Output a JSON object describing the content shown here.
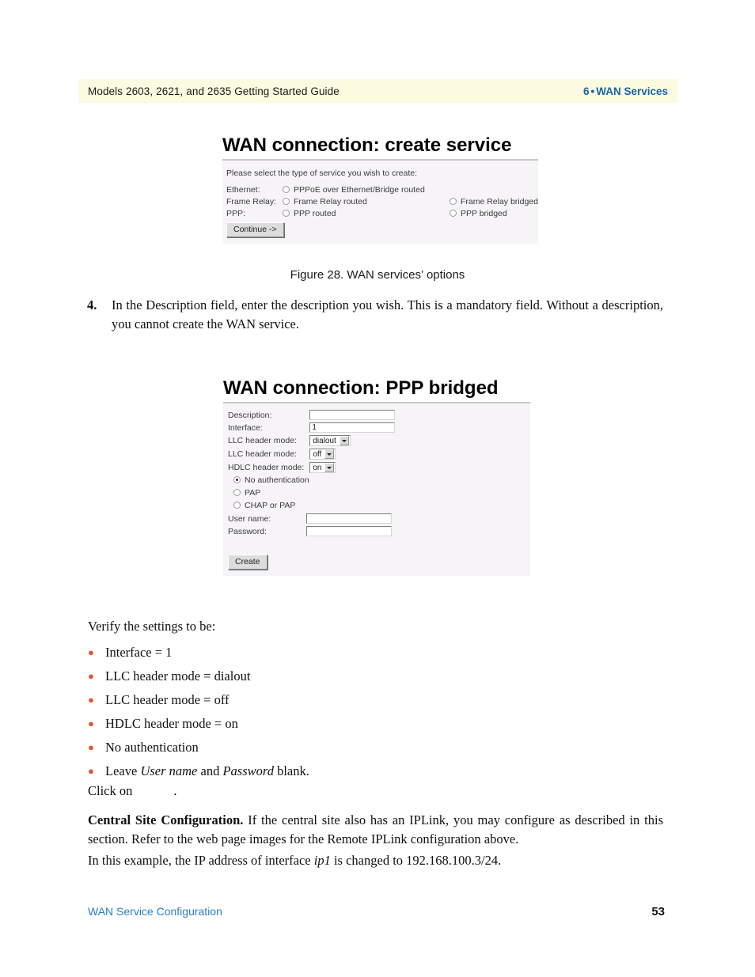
{
  "header": {
    "left_text": "Models 2603, 2621, and 2635 Getting Started Guide",
    "chapter_number": "6",
    "separator": "•",
    "chapter_title": "WAN Services",
    "band_color": "#fdfbdf",
    "accent_color": "#1763a8"
  },
  "figure_create_service": {
    "title": "WAN connection: create service",
    "intro": "Please select the type of service you wish to create:",
    "rows": [
      {
        "label": "Ethernet:",
        "option_left": "PPPoE over Ethernet/Bridge routed",
        "option_left_selected": false,
        "option_right": "",
        "option_right_selected": false
      },
      {
        "label": "Frame Relay:",
        "option_left": "Frame Relay routed",
        "option_left_selected": false,
        "option_right": "Frame Relay bridged",
        "option_right_selected": false
      },
      {
        "label": "PPP:",
        "option_left": "PPP routed",
        "option_left_selected": false,
        "option_right": "PPP bridged",
        "option_right_selected": false
      }
    ],
    "continue_button": "Continue ->"
  },
  "caption_fig28": "Figure 28. WAN services’ options",
  "step_4": {
    "number": "4.",
    "text": "In the Description field, enter the description you wish. This is a mandatory field. Without a description, you cannot create the WAN service."
  },
  "figure_ppp_bridged": {
    "title": "WAN connection: PPP bridged",
    "fields": [
      {
        "label": "Description:",
        "type": "text",
        "value": ""
      },
      {
        "label": "Interface:",
        "type": "text",
        "value": "1"
      },
      {
        "label": "LLC header mode:",
        "type": "select",
        "value": "dialout"
      },
      {
        "label": "LLC header mode:",
        "type": "select",
        "value": "off"
      },
      {
        "label": "HDLC header mode:",
        "type": "select",
        "value": "on"
      }
    ],
    "auth_options": [
      {
        "label": "No authentication",
        "selected": true
      },
      {
        "label": "PAP",
        "selected": false
      },
      {
        "label": "CHAP or PAP",
        "selected": false
      }
    ],
    "credential_fields": [
      {
        "label": "User name:",
        "value": ""
      },
      {
        "label": "Password:",
        "value": ""
      }
    ],
    "create_button": "Create"
  },
  "verify": {
    "lead": "Verify the settings to be:",
    "bullet_color": "#e8502a",
    "items": [
      "Interface = 1",
      "LLC header mode = dialout",
      "LLC header mode = off",
      "HDLC header mode = on",
      "No authentication"
    ],
    "last_item": {
      "prefix": "Leave ",
      "italic_1": "User name",
      "middle": " and ",
      "italic_2": "Password",
      "suffix": " blank."
    }
  },
  "click_on": {
    "prefix": "Click on",
    "suffix": "."
  },
  "central_site": {
    "bold_lead": "Central Site Configuration.",
    "text": " If the central site also has an IPLink, you may configure as described in this section. Refer to the web page images for the Remote IPLink configuration above."
  },
  "example": {
    "prefix": "In this example, the IP address of interface ",
    "italic": "ip1",
    "suffix": " is changed to 192.168.100.3/24."
  },
  "footer": {
    "left_text": "WAN Service Configuration",
    "page_number": "53",
    "link_color": "#2a7fc9"
  }
}
